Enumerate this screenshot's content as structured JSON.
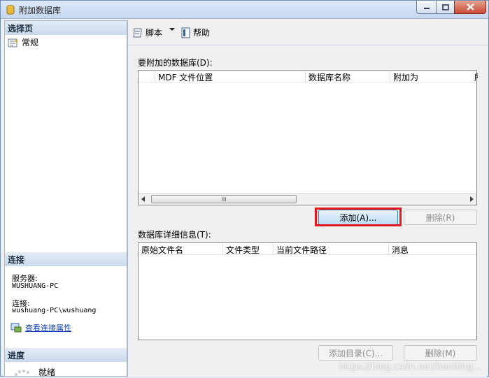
{
  "window": {
    "title": "附加数据库"
  },
  "left_pane": {
    "select_page_header": "选择页",
    "nav_items": [
      {
        "label": "常规"
      }
    ],
    "connection_header": "连接",
    "server_label": "服务器:",
    "server_value": "WUSHUANG-PC",
    "connection_label": "连接:",
    "connection_value": "wushuang-PC\\wushuang",
    "view_connection_link": "查看连接属性",
    "progress_header": "进度",
    "progress_status": "就绪"
  },
  "toolbar": {
    "script_label": "脚本",
    "help_label": "帮助"
  },
  "attach_section": {
    "label": "要附加的数据库(D):",
    "columns": [
      "MDF 文件位置",
      "数据库名称",
      "附加为",
      "所"
    ],
    "scroll_glyph": "III"
  },
  "attach_buttons": {
    "add": "添加(A)...",
    "remove": "删除(R)"
  },
  "details_section": {
    "label": "数据库详细信息(T):",
    "columns": [
      "原始文件名",
      "文件类型",
      "当前文件路径",
      "消息"
    ]
  },
  "details_buttons": {
    "add_catalog": "添加目录(C)...",
    "remove": "删除(M)"
  },
  "watermark": "https://blog.csdn.net/baobing..."
}
